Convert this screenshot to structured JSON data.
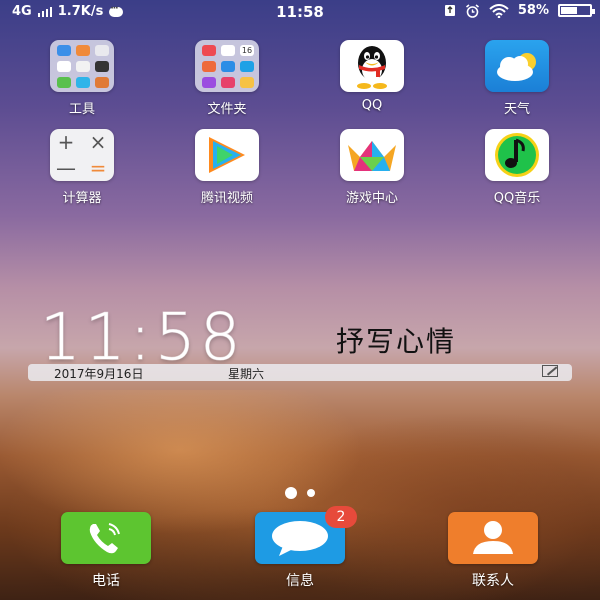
{
  "status_bar": {
    "network": "4G",
    "speed": "1.7K/s",
    "time": "11:58",
    "battery_percent": "58%",
    "battery_level": 0.58
  },
  "apps": [
    {
      "label": "工具",
      "icon": "tools-folder-icon"
    },
    {
      "label": "文件夹",
      "icon": "files-folder-icon"
    },
    {
      "label": "QQ",
      "icon": "qq-penguin-icon"
    },
    {
      "label": "天气",
      "icon": "weather-cloud-sun-icon"
    },
    {
      "label": "计算器",
      "icon": "calculator-icon"
    },
    {
      "label": "腾讯视频",
      "icon": "tencent-video-icon"
    },
    {
      "label": "游戏中心",
      "icon": "game-center-crown-icon"
    },
    {
      "label": "QQ音乐",
      "icon": "qq-music-note-icon"
    }
  ],
  "calculator_symbols": [
    "+",
    "×",
    "—",
    "="
  ],
  "folder_16_label": "16",
  "clock_widget": {
    "time": "11:58",
    "mood": "抒写心情",
    "date": "2017年9月16日",
    "weekday": "星期六"
  },
  "dock": [
    {
      "label": "电话",
      "icon": "phone-icon"
    },
    {
      "label": "信息",
      "icon": "messages-icon",
      "badge": "2"
    },
    {
      "label": "联系人",
      "icon": "contacts-icon"
    }
  ],
  "colors": {
    "phone": "#5dc530",
    "messages": "#1e9be4",
    "contacts": "#ef7e2c",
    "badge": "#e74a3b"
  }
}
